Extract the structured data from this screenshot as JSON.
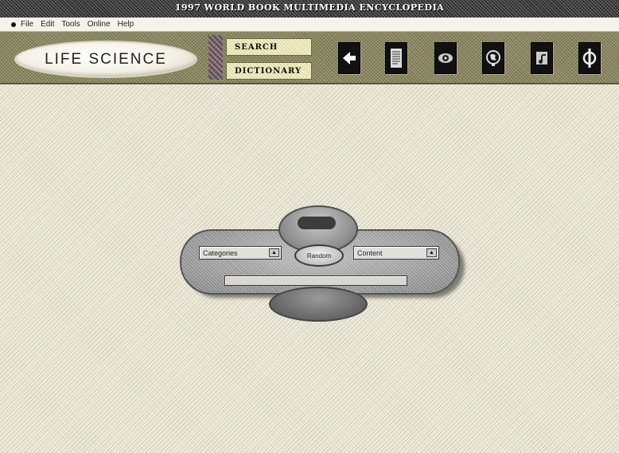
{
  "window": {
    "title": "1997 WORLD BOOK MULTIMEDIA ENCYCLOPEDIA"
  },
  "menubar": {
    "items": [
      "File",
      "Edit",
      "Tools",
      "Online",
      "Help"
    ]
  },
  "toolbar": {
    "volume_label": "LIFE SCIENCE",
    "search_label": "SEARCH",
    "dictionary_label": "DICTIONARY",
    "icons": [
      "back-arrow-icon",
      "article-page-icon",
      "eye-icon",
      "globe-icon",
      "film-music-icon",
      "phi-icon"
    ],
    "accent_color": "#8e8a62"
  },
  "navigator": {
    "top_label": "",
    "categories_value": "Categories",
    "content_value": "Content",
    "center_label": "Random",
    "bar_label": "",
    "bottom_label": ""
  }
}
